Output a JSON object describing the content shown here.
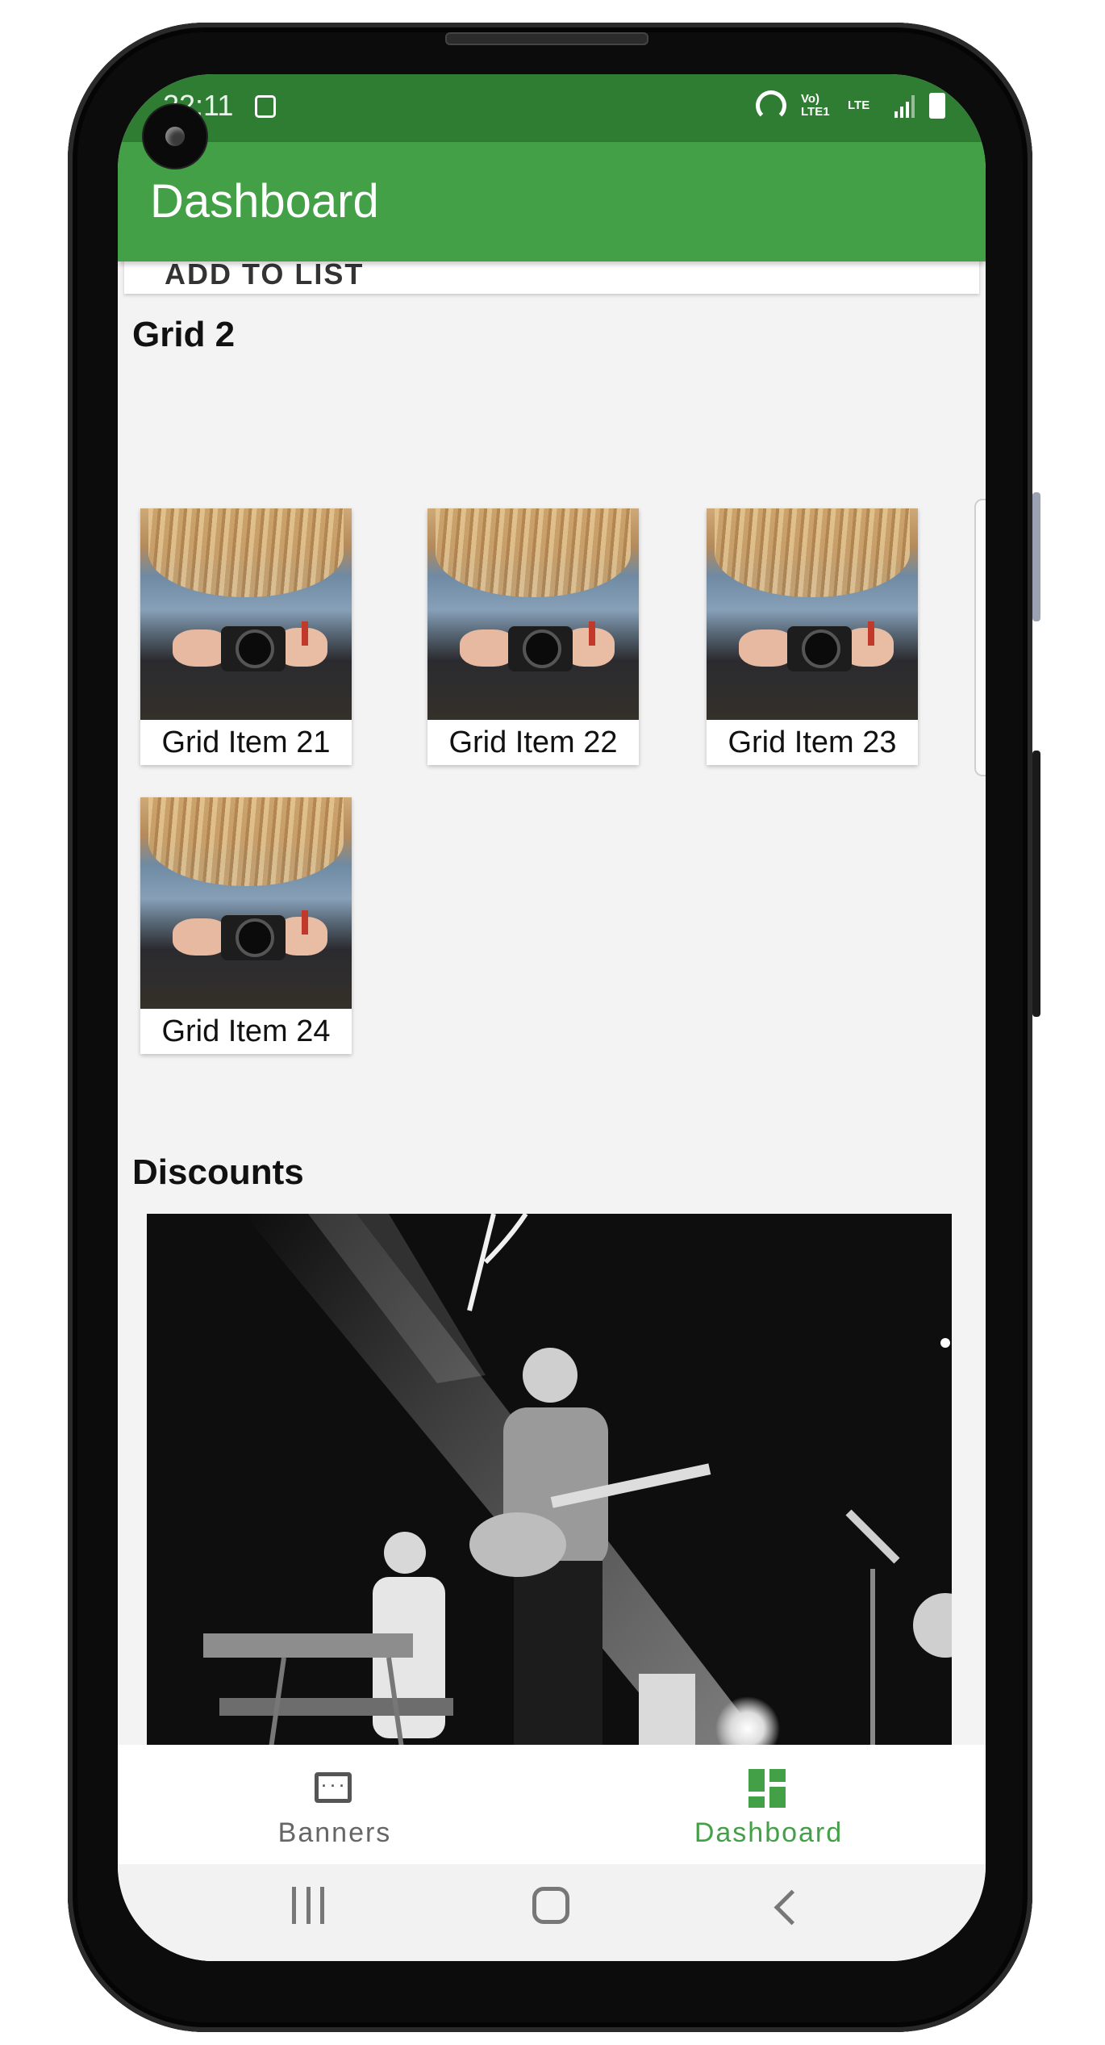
{
  "status_bar": {
    "time": "22:11",
    "icons": [
      "note-icon",
      "hotspot-icon",
      "volte-icon",
      "lte-icon",
      "signal-icon",
      "battery-icon"
    ],
    "volte_text": "Vo) LTE1",
    "lte_text": "LTE"
  },
  "app_bar": {
    "title": "Dashboard"
  },
  "previous_card": {
    "add_to_list": "ADD TO LIST"
  },
  "sections": {
    "grid2": {
      "title": "Grid 2",
      "items": [
        {
          "label": "Grid Item 21"
        },
        {
          "label": "Grid Item 22"
        },
        {
          "label": "Grid Item 23"
        },
        {
          "label": "Grid Item 24"
        }
      ]
    },
    "discounts": {
      "title": "Discounts"
    }
  },
  "bottom_nav": {
    "items": [
      {
        "label": "Banners",
        "icon": "banners-icon",
        "active": false
      },
      {
        "label": "Dashboard",
        "icon": "dashboard-icon",
        "active": true
      }
    ]
  },
  "colors": {
    "primary": "#43a047",
    "primary_dark": "#2e7d32",
    "background": "#f3f3f3",
    "inactive": "#666666"
  }
}
